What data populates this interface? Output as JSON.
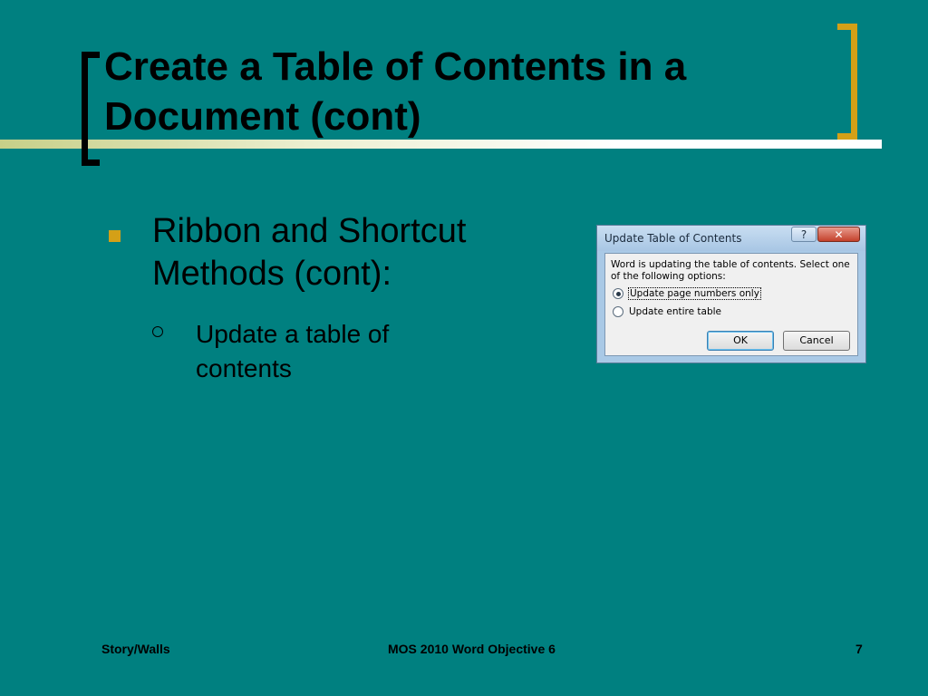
{
  "slide": {
    "title": "Create a Table of Contents in a Document (cont)",
    "bullet_level1": "Ribbon and Shortcut Methods (cont):",
    "bullet_level2": "Update a table of contents"
  },
  "dialog": {
    "title": "Update Table of Contents",
    "help_label": "?",
    "close_label": "✕",
    "message": "Word is updating the table of contents.  Select one of the following options:",
    "options": [
      {
        "label": "Update page numbers only",
        "selected": true
      },
      {
        "label": "Update entire table",
        "selected": false
      }
    ],
    "ok_label": "OK",
    "cancel_label": "Cancel"
  },
  "footer": {
    "left": "Story/Walls",
    "center": "MOS 2010 Word Objective 6",
    "page_number": "7"
  },
  "colors": {
    "background": "#008080",
    "accent": "#d4a017",
    "text": "#000000"
  },
  "icons": {
    "bullet1": "square-bullet-icon",
    "bullet2": "circle-bullet-icon"
  }
}
